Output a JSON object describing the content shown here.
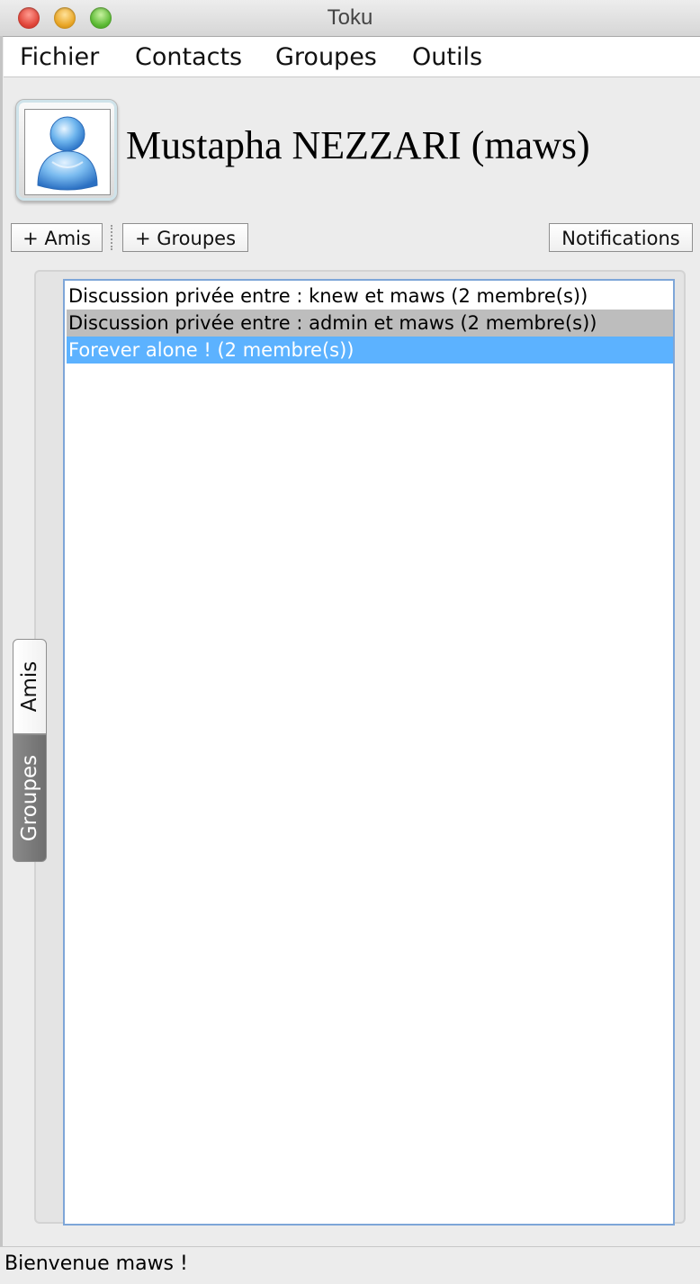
{
  "window": {
    "title": "Toku"
  },
  "menu": {
    "items": [
      "Fichier",
      "Contacts",
      "Groupes",
      "Outils"
    ]
  },
  "profile": {
    "name": "Mustapha NEZZARI (maws)",
    "avatar_icon": "user-avatar-icon"
  },
  "toolbar": {
    "add_friends": "+ Amis",
    "add_groups": "+ Groupes",
    "notifications": "Notifications"
  },
  "tabs": [
    {
      "label": "Amis",
      "selected": false
    },
    {
      "label": "Groupes",
      "selected": true
    }
  ],
  "groups_list": [
    {
      "label": "Discussion privée entre : knew et maws (2 membre(s))",
      "state": "normal"
    },
    {
      "label": "Discussion privée entre : admin et maws (2 membre(s))",
      "state": "hover"
    },
    {
      "label": "Forever alone ! (2 membre(s))",
      "state": "selected"
    }
  ],
  "status": {
    "text": "Bienvenue maws !"
  },
  "colors": {
    "selection": "#5cb2ff",
    "hover": "#bdbdbd",
    "list_border": "#7ea6d8"
  }
}
